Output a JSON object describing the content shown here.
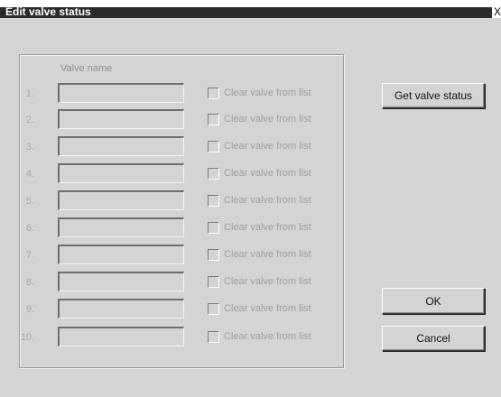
{
  "window": {
    "title": "Edit valve status",
    "close_glyph": "X"
  },
  "group": {
    "column_header": "Valve name",
    "rows": [
      {
        "num": "1.",
        "value": "",
        "checkbox_label": "Clear valve from list",
        "checked": false
      },
      {
        "num": "2.",
        "value": "",
        "checkbox_label": "Clear valve from list",
        "checked": false
      },
      {
        "num": "3.",
        "value": "",
        "checkbox_label": "Clear valve from list",
        "checked": false
      },
      {
        "num": "4.",
        "value": "",
        "checkbox_label": "Clear valve from list",
        "checked": false
      },
      {
        "num": "5.",
        "value": "",
        "checkbox_label": "Clear valve from list",
        "checked": false
      },
      {
        "num": "6.",
        "value": "",
        "checkbox_label": "Clear valve from list",
        "checked": false
      },
      {
        "num": "7.",
        "value": "",
        "checkbox_label": "Clear valve from list",
        "checked": false
      },
      {
        "num": "8.",
        "value": "",
        "checkbox_label": "Clear valve from list",
        "checked": false
      },
      {
        "num": "9.",
        "value": "",
        "checkbox_label": "Clear valve from list",
        "checked": false
      },
      {
        "num": "10.",
        "value": "",
        "checkbox_label": "Clear valve from list",
        "checked": false
      }
    ]
  },
  "buttons": {
    "get_status": "Get valve status",
    "ok": "OK",
    "cancel": "Cancel"
  }
}
